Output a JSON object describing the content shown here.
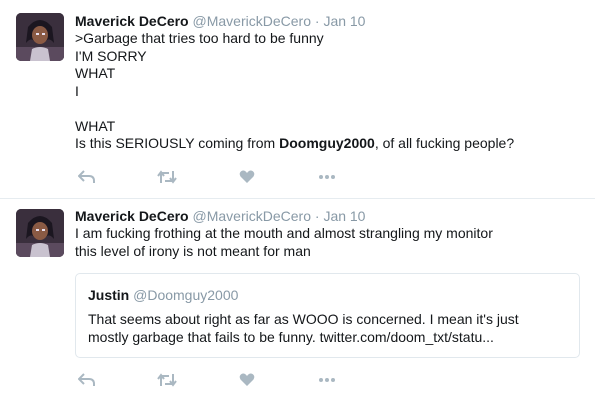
{
  "tweets": [
    {
      "name": "Maverick DeCero",
      "handle": "@MaverickDeCero",
      "separator": "·",
      "date": "Jan 10",
      "lines": [
        ">Garbage that tries too hard to be funny",
        "I'M SORRY",
        "WHAT",
        "I",
        "",
        "WHAT"
      ],
      "last_line": {
        "before": "Is this SERIOUSLY coming from ",
        "mention": "Doomguy2000",
        "after": ", of all fucking people?"
      }
    },
    {
      "name": "Maverick DeCero",
      "handle": "@MaverickDeCero",
      "separator": "·",
      "date": "Jan 10",
      "lines": [
        "I am fucking frothing at the mouth and almost strangling my monitor",
        "this level of irony is not meant for man"
      ],
      "quote": {
        "name": "Justin",
        "handle": "@Doomguy2000",
        "lines": [
          "That seems about right as far as WOOO is concerned.  I mean it's just",
          "mostly garbage that fails to be funny. twitter.com/doom_txt/statu..."
        ]
      }
    }
  ],
  "icons": {
    "reply": "reply-icon",
    "retweet": "retweet-icon",
    "like": "heart-icon",
    "more": "more-dots-icon"
  },
  "colors": {
    "action_gray": "#aab8c2",
    "secondary_text": "#8899a6",
    "border": "#e1e8ed"
  }
}
